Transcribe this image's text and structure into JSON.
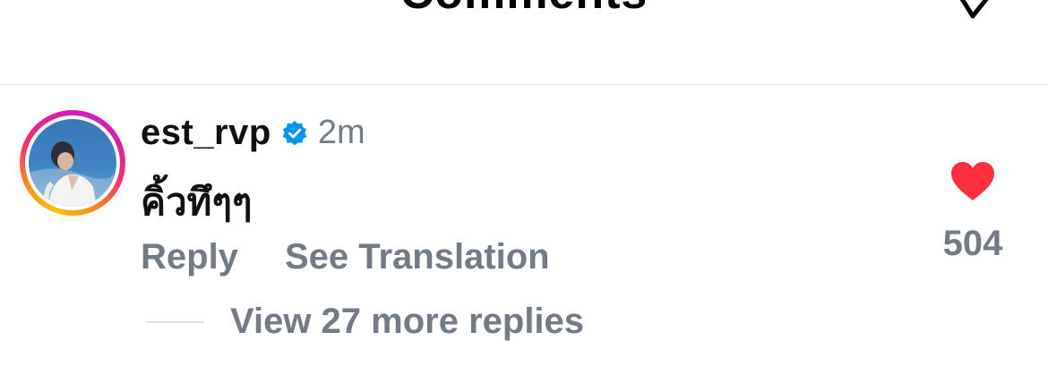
{
  "header": {
    "title": "Comments",
    "share_icon": "send-icon"
  },
  "comment": {
    "avatar_icon": "user-avatar",
    "username": "est_rvp",
    "verified_icon": "verified-badge-icon",
    "timestamp": "2m",
    "text": "คิ้วทึๆๆ",
    "reply_label": "Reply",
    "translate_label": "See Translation",
    "view_replies_label": "View 27 more replies",
    "like_icon": "heart-icon",
    "like_count": "504",
    "like_color": "#ff3040",
    "verified_color": "#0095f6",
    "muted_color": "#737b86"
  }
}
